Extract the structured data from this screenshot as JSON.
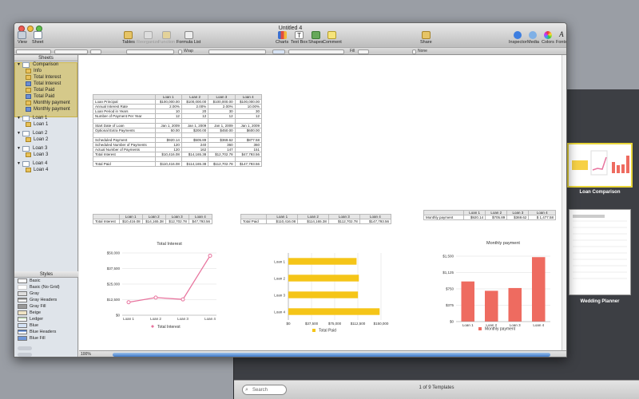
{
  "window": {
    "title": "Untitled 4"
  },
  "toolbar": {
    "left": [
      {
        "label": "View"
      },
      {
        "label": "Sheet"
      }
    ],
    "center": [
      {
        "label": "Tables",
        "enabled": true
      },
      {
        "label": "Reorganize",
        "enabled": false
      },
      {
        "label": "Function",
        "enabled": false
      },
      {
        "label": "Formula List",
        "enabled": true
      }
    ],
    "insert": [
      {
        "label": "Charts"
      },
      {
        "label": "Text Box"
      },
      {
        "label": "Shapes"
      },
      {
        "label": "Comment"
      }
    ],
    "share": "Share",
    "right": [
      {
        "label": "Inspector"
      },
      {
        "label": "Media"
      },
      {
        "label": "Colors"
      },
      {
        "label": "Fonts"
      }
    ]
  },
  "format_bar": {
    "wrap": "Wrap",
    "fill": "Fill",
    "none": "None"
  },
  "sidebar": {
    "header": "Sheets",
    "sheets": [
      {
        "name": "Comparison",
        "items": [
          "Info",
          "Total Interest",
          "Total Interest",
          "Total Paid",
          "Total Paid",
          "Monthly payment",
          "Monthly payment"
        ]
      },
      {
        "name": "Loan 1",
        "items": [
          "Loan 1"
        ]
      },
      {
        "name": "Loan 2",
        "items": [
          "Loan 2"
        ]
      },
      {
        "name": "Loan 3",
        "items": [
          "Loan 3"
        ]
      },
      {
        "name": "Loan 4",
        "items": [
          "Loan 4"
        ]
      }
    ],
    "styles_header": "Styles",
    "styles": [
      "Basic",
      "Basic (No Grid)",
      "Gray",
      "Gray Headers",
      "Gray Fill",
      "Beige",
      "Ledger",
      "Blue",
      "Blue Headers",
      "Blue Fill"
    ]
  },
  "status": {
    "zoom": "100%"
  },
  "main_table": {
    "headers": [
      "",
      "Loan 1",
      "Loan 2",
      "Loan 3",
      "Loan 4"
    ],
    "rows": [
      [
        "Loan Principal",
        "$100,000.00",
        "$100,000.00",
        "$100,000.00",
        "$100,000.00"
      ],
      [
        "Annual Interest Rate",
        "2.00%",
        "2.00%",
        "2.00%",
        "10.00%"
      ],
      [
        "Loan Period in Years",
        "10",
        "20",
        "30",
        "30"
      ],
      [
        "Number of Payment Per Year",
        "12",
        "12",
        "12",
        "12"
      ],
      [
        "",
        "",
        "",
        "",
        ""
      ],
      [
        "Start Date of Loan",
        "Jan 1, 2009",
        "Jan 1, 2009",
        "Jan 1, 2009",
        "Jan 1, 2009"
      ],
      [
        "Optional Extra Payments",
        "50.00",
        "$200.00",
        "$450.00",
        "$600.00"
      ],
      [
        "",
        "",
        "",
        "",
        ""
      ],
      [
        "Scheduled Payment",
        "$920.14",
        "$505.89",
        "$369.62",
        "$877.58"
      ],
      [
        "Scheduled Number of Payments",
        "120",
        "240",
        "360",
        "360"
      ],
      [
        "Actual Number of Payments",
        "120",
        "162",
        "147",
        "151"
      ],
      [
        "Total Interest",
        "$10,416.08",
        "$14,165.38",
        "$12,702.78",
        "$47,793.56"
      ],
      [
        "",
        "",
        "",
        "",
        ""
      ],
      [
        "Total Paid",
        "$110,416.08",
        "$114,165.38",
        "$112,702.78",
        "$147,793.56"
      ]
    ]
  },
  "summary_tables": [
    {
      "headers": [
        "",
        "Loan 1",
        "Loan 2",
        "Loan 3",
        "Loan 4"
      ],
      "row": [
        "Total Interest",
        "$10,416.08",
        "$14,165.38",
        "$12,702.78",
        "$47,793.56"
      ]
    },
    {
      "headers": [
        "",
        "Loan 1",
        "Loan 2",
        "Loan 3",
        "Loan 4"
      ],
      "row": [
        "Total Paid",
        "$110,416.08",
        "$114,165.38",
        "$112,702.78",
        "$147,793.56"
      ]
    },
    {
      "headers": [
        "",
        "Loan 1",
        "Loan 2",
        "Loan 3",
        "Loan 4"
      ],
      "row": [
        "Monthly payment",
        "$920.14",
        "$705.89",
        "$369.62",
        "$ 1,477.58"
      ]
    }
  ],
  "chart_data": [
    {
      "type": "line",
      "title": "Total Interest",
      "categories": [
        "Loan 1",
        "Loan 2",
        "Loan 3",
        "Loan 4"
      ],
      "series": [
        {
          "name": "Total Interest",
          "values": [
            10416.08,
            14165.38,
            12702.78,
            47793.56
          ]
        }
      ],
      "ylim": [
        0,
        50000
      ],
      "yticks": [
        "$0",
        "$12,500",
        "$25,000",
        "$37,500",
        "$50,000"
      ],
      "color": "#e8749e",
      "legend": "bottom"
    },
    {
      "type": "bar",
      "title": "",
      "categories": [
        "Loan 1",
        "Loan 2",
        "Loan 3",
        "Loan 4"
      ],
      "series": [
        {
          "name": "Total Paid",
          "values": [
            110416.08,
            114165.38,
            112702.78,
            147793.56
          ]
        }
      ],
      "xlim": [
        0,
        150000
      ],
      "xticks": [
        "$0",
        "$37,500",
        "$75,000",
        "$112,500",
        "$150,000"
      ],
      "color": "#f5c518",
      "legend": "bottom",
      "orientation": "horizontal"
    },
    {
      "type": "bar",
      "title": "Monthly payment",
      "categories": [
        "Loan 1",
        "Loan 2",
        "Loan 3",
        "Loan 4"
      ],
      "series": [
        {
          "name": "Monthly payment",
          "values": [
            920.14,
            705.89,
            769.62,
            1477.58
          ]
        }
      ],
      "ylim": [
        0,
        1500
      ],
      "yticks": [
        "$0",
        "$375",
        "$750",
        "$1,125",
        "$1,500"
      ],
      "color": "#ee6b60",
      "legend": "bottom"
    }
  ],
  "templates": {
    "search_placeholder": "Search",
    "count": "1 of 9 Templates",
    "items": [
      "Loan Comparison",
      "Wedding Planner"
    ]
  }
}
